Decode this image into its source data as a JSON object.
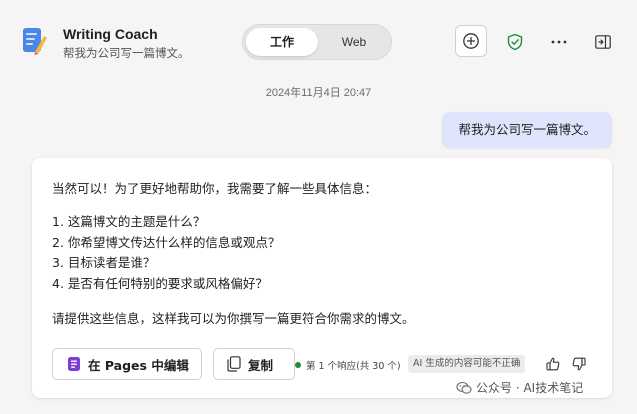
{
  "app": {
    "title": "Writing Coach",
    "subtitle": "帮我为公司写一篇博文。"
  },
  "mode_toggle": {
    "options": [
      "工作",
      "Web"
    ],
    "selected": "工作"
  },
  "header_icons": [
    "new-chat-icon",
    "shield-check-icon",
    "more-icon",
    "side-panel-icon"
  ],
  "colors": {
    "accent": "#dfe3fb",
    "shield": "#1f8a3a",
    "pages_icon": "#7b3fd6"
  },
  "conversation": {
    "timestamp": "2024年11月4日 20:47",
    "user_message": "帮我为公司写一篇博文。",
    "reply": {
      "intro": "当然可以！为了更好地帮助你，我需要了解一些具体信息：",
      "items": [
        "1.  这篇博文的主题是什么？",
        "2.  你希望博文传达什么样的信息或观点？",
        "3.  目标读者是谁？",
        "4.  是否有任何特别的要求或风格偏好？"
      ],
      "outro": "请提供这些信息，这样我可以为你撰写一篇更符合你需求的博文。"
    },
    "actions": {
      "edit_in_pages": "在 Pages 中编辑",
      "copy": "复制"
    },
    "response_info": "第 1 个响应(共 30 个)",
    "ai_disclaimer": "AI 生成的内容可能不正确"
  },
  "watermark": "公众号 · AI技术笔记"
}
